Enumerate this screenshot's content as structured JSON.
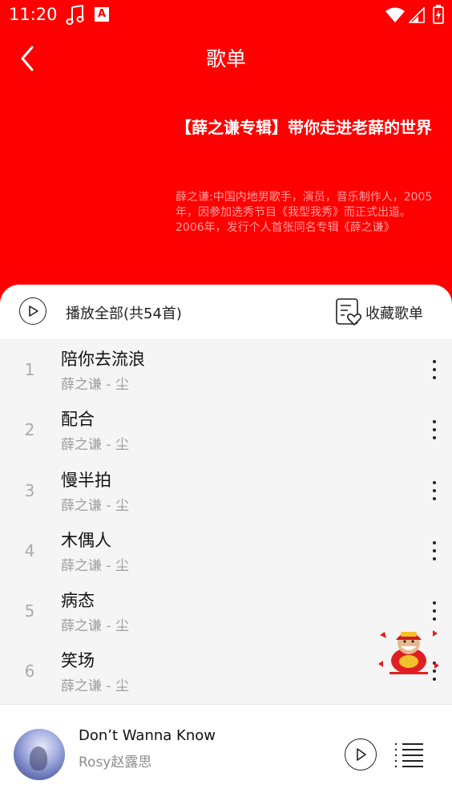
{
  "status_bar": {
    "time": "11:20",
    "icons": [
      "music-note-icon",
      "a-badge-icon",
      "wifi-icon",
      "signal-icon",
      "battery-icon"
    ],
    "badge_letter": "A"
  },
  "nav": {
    "back_icon": "chevron-left-icon",
    "title": "歌单"
  },
  "playlist": {
    "title": "【薛之谦专辑】带你走进老薛的世界",
    "description": "薛之谦:中国内地男歌手，演员，音乐制作人，2005年，因参加选秀节目《我型我秀》而正式出道。2006年，发行个人首张同名专辑《薛之谦》"
  },
  "actions": {
    "play_all_label": "播放全部(共54首)",
    "collect_label": "收藏歌单",
    "play_all_icon": "play-circle-icon",
    "collect_icon": "playlist-heart-icon"
  },
  "songs": [
    {
      "index": "1",
      "name": "陪你去流浪",
      "artist": "薛之谦 - 尘"
    },
    {
      "index": "2",
      "name": "配合",
      "artist": "薛之谦 - 尘"
    },
    {
      "index": "3",
      "name": "慢半拍",
      "artist": "薛之谦 - 尘"
    },
    {
      "index": "4",
      "name": "木偶人",
      "artist": "薛之谦 - 尘"
    },
    {
      "index": "5",
      "name": "病态",
      "artist": "薛之谦 - 尘"
    },
    {
      "index": "6",
      "name": "笑场",
      "artist": "薛之谦 - 尘"
    }
  ],
  "player": {
    "title": "Don’t Wanna Know",
    "artist": "Rosy赵露思",
    "play_icon": "play-circle-icon",
    "queue_icon": "queue-list-icon"
  },
  "colors": {
    "header": "#ff0000",
    "list_bg": "#f5f5f5",
    "secondary_text": "#9e9e9e"
  }
}
